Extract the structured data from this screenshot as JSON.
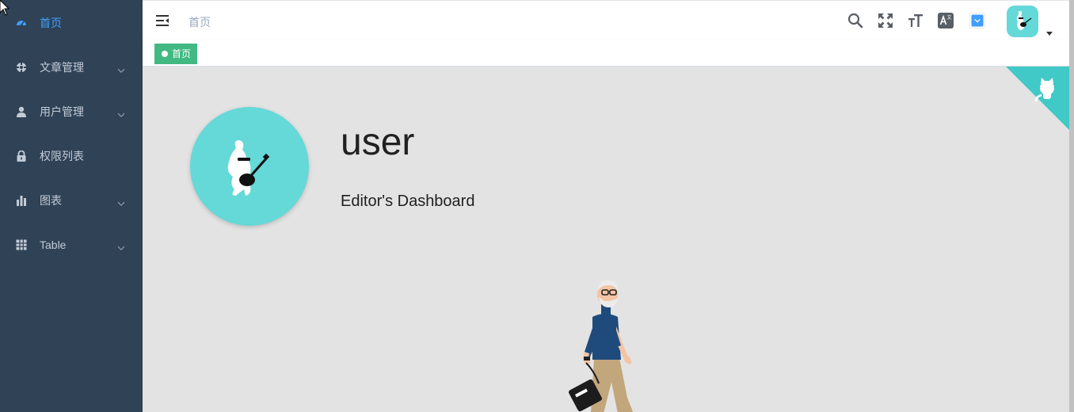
{
  "sidebar": {
    "items": [
      {
        "label": "首页",
        "icon": "dashboard-icon",
        "active": true,
        "has_children": false
      },
      {
        "label": "文章管理",
        "icon": "article-icon",
        "active": false,
        "has_children": true
      },
      {
        "label": "用户管理",
        "icon": "user-icon",
        "active": false,
        "has_children": true
      },
      {
        "label": "权限列表",
        "icon": "lock-icon",
        "active": false,
        "has_children": false
      },
      {
        "label": "图表",
        "icon": "chart-icon",
        "active": false,
        "has_children": true
      },
      {
        "label": "Table",
        "icon": "table-icon",
        "active": false,
        "has_children": true
      }
    ]
  },
  "navbar": {
    "breadcrumb": "首页",
    "icons": [
      "search-icon",
      "fullscreen-icon",
      "font-size-icon",
      "language-icon",
      "theme-picker-icon"
    ],
    "theme_color": "#409eff"
  },
  "tags_view": {
    "tags": [
      {
        "label": "首页",
        "active": true
      }
    ]
  },
  "dashboard": {
    "name": "user",
    "role": "Editor's Dashboard"
  },
  "colors": {
    "sidebar_bg": "#2f4256",
    "sidebar_text": "#c3cbd6",
    "active": "#409eff",
    "tag_active": "#42b983",
    "avatar_bg": "#65d8d8",
    "main_bg": "#e3e3e3",
    "github_corner": "#40c9c6"
  }
}
